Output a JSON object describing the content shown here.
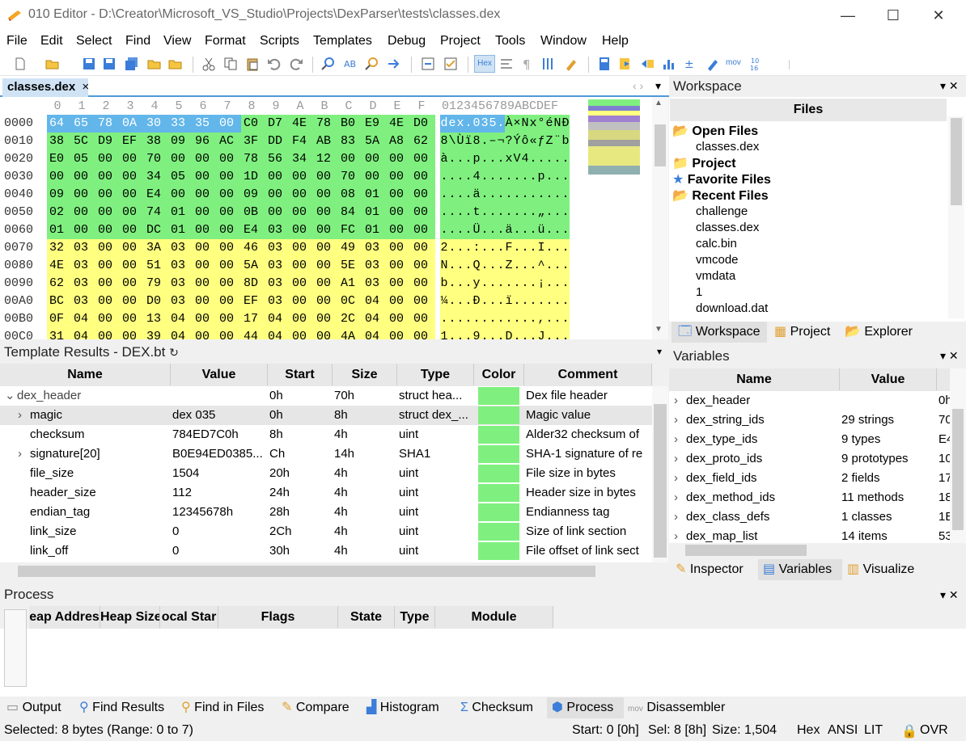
{
  "window": {
    "title": "010 Editor - D:\\Creator\\Microsoft_VS_Studio\\Projects\\DexParser\\tests\\classes.dex",
    "minimize": "—",
    "maximize": "☐",
    "close": "✕"
  },
  "menu": [
    "File",
    "Edit",
    "Select",
    "Find",
    "View",
    "Format",
    "Scripts",
    "Templates",
    "Debug",
    "Project",
    "Tools",
    "Window",
    "Help"
  ],
  "toolbar": {
    "hex_label": "Hex",
    "mov_label": "mov"
  },
  "file_tab": {
    "label": "classes.dex",
    "close": "×"
  },
  "hex": {
    "column_headers": [
      "0",
      "1",
      "2",
      "3",
      "4",
      "5",
      "6",
      "7",
      "8",
      "9",
      "A",
      "B",
      "C",
      "D",
      "E",
      "F"
    ],
    "ascii_header": "0123456789ABCDEF",
    "rows": [
      {
        "addr": "0000",
        "bytes": [
          "64",
          "65",
          "78",
          "0A",
          "30",
          "33",
          "35",
          "00",
          "C0",
          "D7",
          "4E",
          "78",
          "B0",
          "E9",
          "4E",
          "D0"
        ],
        "ascii": "dex.035.À×Nx°éNÐ"
      },
      {
        "addr": "0010",
        "bytes": [
          "38",
          "5C",
          "D9",
          "EF",
          "38",
          "09",
          "96",
          "AC",
          "3F",
          "DD",
          "F4",
          "AB",
          "83",
          "5A",
          "A8",
          "62"
        ],
        "ascii": "8\\Ùï8.–¬?Ýô«ƒZ¨b"
      },
      {
        "addr": "0020",
        "bytes": [
          "E0",
          "05",
          "00",
          "00",
          "70",
          "00",
          "00",
          "00",
          "78",
          "56",
          "34",
          "12",
          "00",
          "00",
          "00",
          "00"
        ],
        "ascii": "à...p...xV4....."
      },
      {
        "addr": "0030",
        "bytes": [
          "00",
          "00",
          "00",
          "00",
          "34",
          "05",
          "00",
          "00",
          "1D",
          "00",
          "00",
          "00",
          "70",
          "00",
          "00",
          "00"
        ],
        "ascii": "....4.......p..."
      },
      {
        "addr": "0040",
        "bytes": [
          "09",
          "00",
          "00",
          "00",
          "E4",
          "00",
          "00",
          "00",
          "09",
          "00",
          "00",
          "00",
          "08",
          "01",
          "00",
          "00"
        ],
        "ascii": "....ä..........."
      },
      {
        "addr": "0050",
        "bytes": [
          "02",
          "00",
          "00",
          "00",
          "74",
          "01",
          "00",
          "00",
          "0B",
          "00",
          "00",
          "00",
          "84",
          "01",
          "00",
          "00"
        ],
        "ascii": "....t.......„..."
      },
      {
        "addr": "0060",
        "bytes": [
          "01",
          "00",
          "00",
          "00",
          "DC",
          "01",
          "00",
          "00",
          "E4",
          "03",
          "00",
          "00",
          "FC",
          "01",
          "00",
          "00"
        ],
        "ascii": "....Ü...ä...ü..."
      },
      {
        "addr": "0070",
        "bytes": [
          "32",
          "03",
          "00",
          "00",
          "3A",
          "03",
          "00",
          "00",
          "46",
          "03",
          "00",
          "00",
          "49",
          "03",
          "00",
          "00"
        ],
        "ascii": "2...:...F...I..."
      },
      {
        "addr": "0080",
        "bytes": [
          "4E",
          "03",
          "00",
          "00",
          "51",
          "03",
          "00",
          "00",
          "5A",
          "03",
          "00",
          "00",
          "5E",
          "03",
          "00",
          "00"
        ],
        "ascii": "N...Q...Z...^..."
      },
      {
        "addr": "0090",
        "bytes": [
          "62",
          "03",
          "00",
          "00",
          "79",
          "03",
          "00",
          "00",
          "8D",
          "03",
          "00",
          "00",
          "A1",
          "03",
          "00",
          "00"
        ],
        "ascii": "b...y.......¡..."
      },
      {
        "addr": "00A0",
        "bytes": [
          "BC",
          "03",
          "00",
          "00",
          "D0",
          "03",
          "00",
          "00",
          "EF",
          "03",
          "00",
          "00",
          "0C",
          "04",
          "00",
          "00"
        ],
        "ascii": "¼...Ð...ï......."
      },
      {
        "addr": "00B0",
        "bytes": [
          "0F",
          "04",
          "00",
          "00",
          "13",
          "04",
          "00",
          "00",
          "17",
          "04",
          "00",
          "00",
          "2C",
          "04",
          "00",
          "00"
        ],
        "ascii": "............,..."
      },
      {
        "addr": "00C0",
        "bytes": [
          "31",
          "04",
          "00",
          "00",
          "39",
          "04",
          "00",
          "00",
          "44",
          "04",
          "00",
          "00",
          "4A",
          "04",
          "00",
          "00"
        ],
        "ascii": "1...9...D...J..."
      }
    ],
    "colors": {
      "selected": "#62b6ea",
      "green": "#7ff07f",
      "yellow": "#ffff80"
    }
  },
  "template": {
    "title": "Template Results - DEX.bt",
    "refresh_icon": "↻",
    "headers": [
      "Name",
      "Value",
      "Start",
      "Size",
      "Type",
      "Color",
      "Comment"
    ],
    "rows": [
      {
        "name": "dex_header",
        "value": "",
        "start": "0h",
        "size": "70h",
        "type": "struct hea...",
        "comment": "Dex file header",
        "expander": "⌄",
        "indent": 0
      },
      {
        "name": "magic",
        "value": "dex 035",
        "start": "0h",
        "size": "8h",
        "type": "struct dex_...",
        "comment": "Magic value",
        "expander": "›",
        "indent": 1
      },
      {
        "name": "checksum",
        "value": "784ED7C0h",
        "start": "8h",
        "size": "4h",
        "type": "uint",
        "comment": "Alder32 checksum of",
        "expander": "",
        "indent": 1
      },
      {
        "name": "signature[20]",
        "value": "B0E94ED0385...",
        "start": "Ch",
        "size": "14h",
        "type": "SHA1",
        "comment": "SHA-1 signature of re",
        "expander": "›",
        "indent": 1
      },
      {
        "name": "file_size",
        "value": "1504",
        "start": "20h",
        "size": "4h",
        "type": "uint",
        "comment": "File size in bytes",
        "expander": "",
        "indent": 1
      },
      {
        "name": "header_size",
        "value": "112",
        "start": "24h",
        "size": "4h",
        "type": "uint",
        "comment": "Header size in bytes",
        "expander": "",
        "indent": 1
      },
      {
        "name": "endian_tag",
        "value": "12345678h",
        "start": "28h",
        "size": "4h",
        "type": "uint",
        "comment": "Endianness tag",
        "expander": "",
        "indent": 1
      },
      {
        "name": "link_size",
        "value": "0",
        "start": "2Ch",
        "size": "4h",
        "type": "uint",
        "comment": "Size of link section",
        "expander": "",
        "indent": 1
      },
      {
        "name": "link_off",
        "value": "0",
        "start": "30h",
        "size": "4h",
        "type": "uint",
        "comment": "File offset of link sect",
        "expander": "",
        "indent": 1
      }
    ]
  },
  "workspace": {
    "title": "Workspace",
    "files_header": "Files",
    "open_files": "Open Files",
    "open_list": [
      "classes.dex"
    ],
    "project": "Project",
    "favorite": "Favorite Files",
    "recent": "Recent Files",
    "recent_list": [
      "challenge",
      "classes.dex",
      "calc.bin",
      "vmcode",
      "vmdata",
      "1",
      "download.dat"
    ],
    "tabs": [
      "Workspace",
      "Project",
      "Explorer"
    ]
  },
  "variables": {
    "title": "Variables",
    "headers": [
      "Name",
      "Value"
    ],
    "rows": [
      {
        "name": "dex_header",
        "value": "",
        "extra": "0h"
      },
      {
        "name": "dex_string_ids",
        "value": "29 strings",
        "extra": "70"
      },
      {
        "name": "dex_type_ids",
        "value": "9 types",
        "extra": "E4"
      },
      {
        "name": "dex_proto_ids",
        "value": "9 prototypes",
        "extra": "10"
      },
      {
        "name": "dex_field_ids",
        "value": "2 fields",
        "extra": "17"
      },
      {
        "name": "dex_method_ids",
        "value": "11 methods",
        "extra": "18"
      },
      {
        "name": "dex_class_defs",
        "value": "1 classes",
        "extra": "1E"
      },
      {
        "name": "dex_map_list",
        "value": "14 items",
        "extra": "53"
      }
    ],
    "tabs": [
      "Inspector",
      "Variables",
      "Visualize"
    ]
  },
  "process": {
    "title": "Process",
    "headers": [
      "eap Addres",
      "Heap Size",
      "ocal Star",
      "Flags",
      "State",
      "Type",
      "Module"
    ]
  },
  "bottom_tabs": [
    "Output",
    "Find Results",
    "Find in Files",
    "Compare",
    "Histogram",
    "Checksum",
    "Process",
    "Disassembler"
  ],
  "status": {
    "selected": "Selected: 8 bytes (Range: 0 to 7)",
    "start": "Start: 0 [0h]",
    "sel": "Sel: 8 [8h]",
    "size": "Size: 1,504",
    "hex": "Hex",
    "ansi": "ANSI",
    "lit": "LIT",
    "ovr": "OVR"
  }
}
